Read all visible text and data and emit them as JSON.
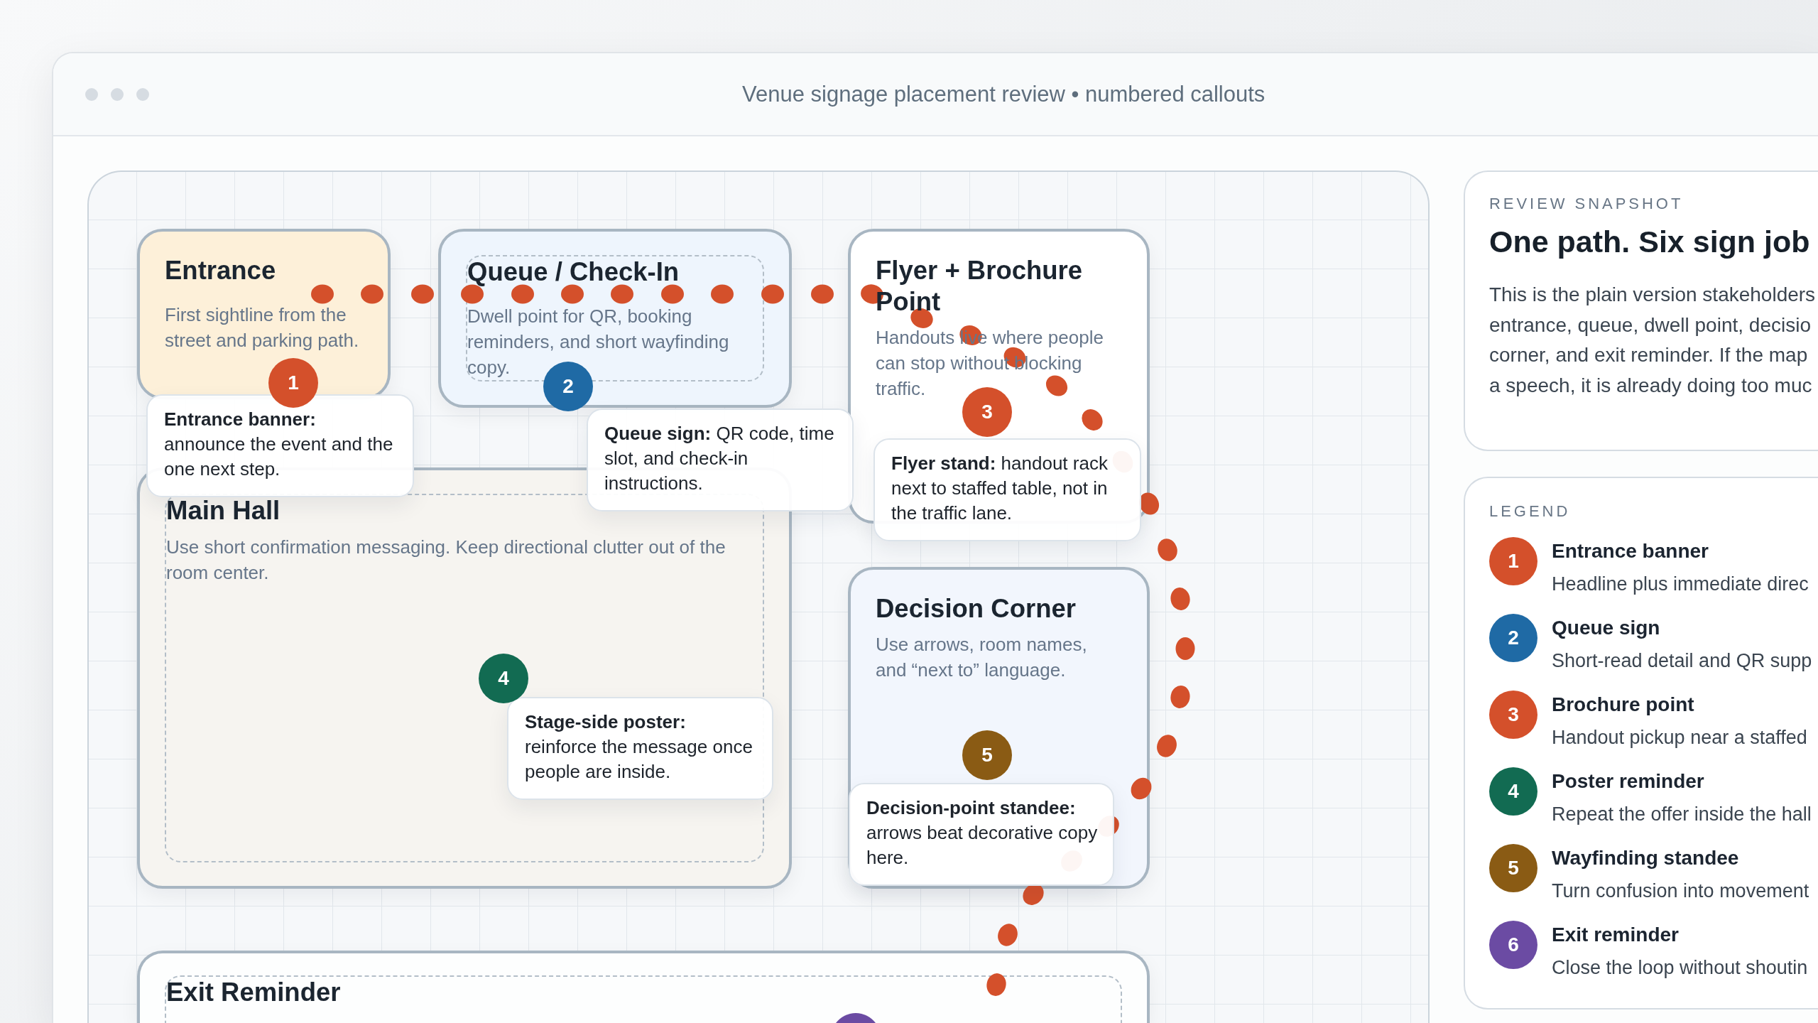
{
  "window": {
    "title": "Venue signage placement review • numbered callouts"
  },
  "map": {
    "zones": [
      {
        "title": "Entrance",
        "description": "First sightline from the street and parking path.",
        "color": "#fdf0d9",
        "dashed": false
      },
      {
        "title": "Queue / Check-In",
        "description": "Dwell point for QR, booking reminders, and short wayfinding copy.",
        "color": "#eef5fd",
        "dashed": true
      },
      {
        "title": "Flyer + Brochure Point",
        "description": "Handouts live where people can stop without blocking traffic.",
        "color": "#ffffff",
        "dashed": false
      },
      {
        "title": "Main Hall",
        "description": "Use short confirmation messaging. Keep directional clutter out of the room center.",
        "color": "#f6f4f0",
        "dashed": true
      },
      {
        "title": "Decision Corner",
        "description": "Use arrows, room names, and “next to” language.",
        "color": "#f2f6fd",
        "dashed": false
      },
      {
        "title": "Exit Reminder",
        "color": "#fdfefe",
        "dashed": true,
        "marker": {
          "color": "#6b4ba3"
        }
      }
    ],
    "callouts": [
      {
        "number": "1",
        "color": "#d4502b",
        "text": "**Entrance banner:** announce the event and the one next step."
      },
      {
        "number": "2",
        "color": "#1f6aa5",
        "text": "**Queue sign:** QR code, time slot, and check-in instructions."
      },
      {
        "number": "3",
        "color": "#d4502b",
        "text": "**Flyer stand:** handout rack next to staffed table, not in the traffic lane."
      },
      {
        "number": "4",
        "color": "#126b52",
        "text": "**Stage-side poster:** reinforce the message once people are inside."
      },
      {
        "number": "5",
        "color": "#8a5b14",
        "text": "**Decision-point standee:** arrows beat decorative copy here."
      }
    ]
  },
  "snapshot": {
    "label": "REVIEW SNAPSHOT",
    "heading": "One path. Six sign job",
    "lines": [
      "This is the plain version stakeholders",
      "entrance, queue, dwell point, decisio",
      "corner, and exit reminder. If the map",
      "a speech, it is already doing too muc"
    ]
  },
  "legend": {
    "label": "LEGEND",
    "items": [
      {
        "number": "1",
        "color": "#d4502b",
        "title": "Entrance banner",
        "description": "Headline plus immediate direc"
      },
      {
        "number": "2",
        "color": "#1f6aa5",
        "title": "Queue sign",
        "description": "Short-read detail and QR supp"
      },
      {
        "number": "3",
        "color": "#d4502b",
        "title": "Brochure point",
        "description": "Handout pickup near a staffed"
      },
      {
        "number": "4",
        "color": "#126b52",
        "title": "Poster reminder",
        "description": "Repeat the offer inside the hall"
      },
      {
        "number": "5",
        "color": "#8a5b14",
        "title": "Wayfinding standee",
        "description": "Turn confusion into movement"
      },
      {
        "number": "6",
        "color": "#6b4ba3",
        "title": "Exit reminder",
        "description": "Close the loop without shoutin"
      }
    ]
  }
}
